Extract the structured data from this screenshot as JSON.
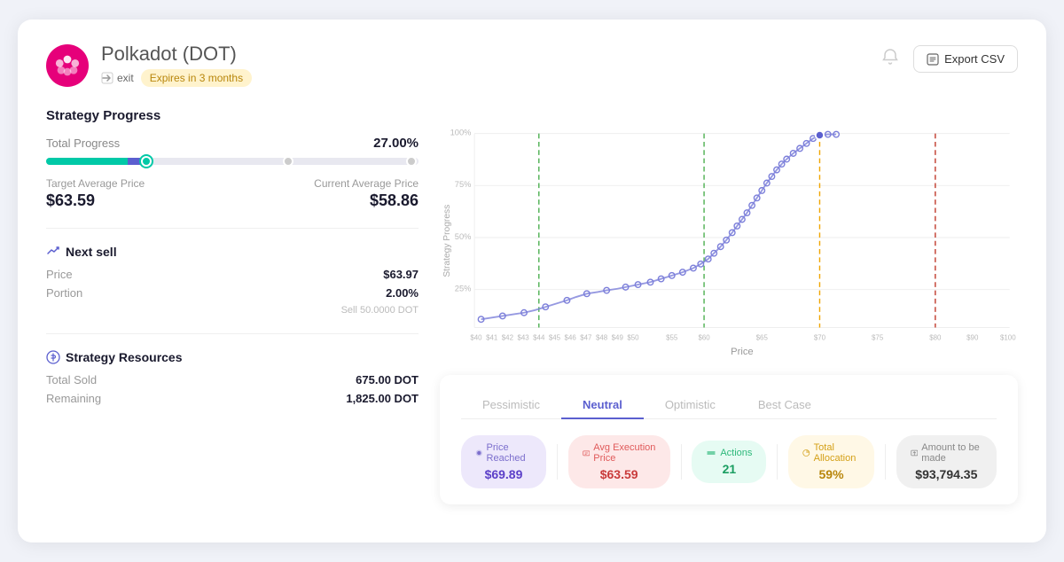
{
  "header": {
    "logo_alt": "Polkadot logo",
    "title": "Polkadot",
    "ticker": "(DOT)",
    "exit_label": "exit",
    "expires_label": "Expires in 3 months",
    "bell_label": "notifications",
    "export_label": "Export CSV"
  },
  "strategy_progress": {
    "section_title": "Strategy Progress",
    "total_progress_label": "Total Progress",
    "total_progress_value": "27.00%",
    "target_avg_label": "Target Average Price",
    "target_avg_value": "$63.59",
    "current_avg_label": "Current Average Price",
    "current_avg_value": "$58.86"
  },
  "next_sell": {
    "title": "Next sell",
    "price_label": "Price",
    "price_value": "$63.97",
    "portion_label": "Portion",
    "portion_value": "2.00%",
    "sell_note": "Sell 50.0000 DOT"
  },
  "resources": {
    "title": "Strategy Resources",
    "total_sold_label": "Total Sold",
    "total_sold_value": "675.00 DOT",
    "remaining_label": "Remaining",
    "remaining_value": "1,825.00 DOT"
  },
  "chart": {
    "x_label": "Price",
    "y_label": "Strategy Progress",
    "dashed_lines": [
      {
        "color": "#4caf50",
        "x_pct": 17
      },
      {
        "color": "#4caf50",
        "x_pct": 43
      },
      {
        "color": "#f0a500",
        "x_pct": 62
      },
      {
        "color": "#e05a5a",
        "x_pct": 87
      }
    ]
  },
  "scenarios": {
    "tabs": [
      {
        "label": "Pessimistic",
        "active": false
      },
      {
        "label": "Neutral",
        "active": true
      },
      {
        "label": "Optimistic",
        "active": false
      },
      {
        "label": "Best Case",
        "active": false
      }
    ],
    "metrics": [
      {
        "label": "Price Reached",
        "value": "$69.89",
        "chip_class": "chip-purple",
        "icon": "price-icon"
      },
      {
        "label": "Avg Execution Price",
        "value": "$63.59",
        "chip_class": "chip-red",
        "icon": "avg-price-icon"
      },
      {
        "label": "Actions",
        "value": "21",
        "chip_class": "chip-green",
        "icon": "actions-icon"
      },
      {
        "label": "Total Allocation",
        "value": "59%",
        "chip_class": "chip-yellow",
        "icon": "allocation-icon"
      },
      {
        "label": "Amount to be made",
        "value": "$93,794.35",
        "chip_class": "chip-gray",
        "icon": "amount-icon"
      }
    ]
  }
}
